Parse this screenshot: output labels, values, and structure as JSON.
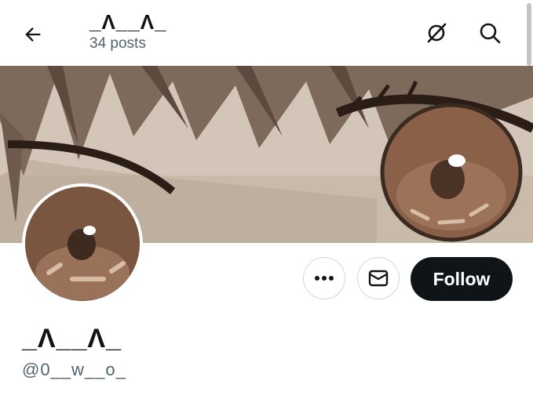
{
  "header": {
    "title": "_Λ__Λ_",
    "post_count": "34 posts",
    "back_icon": "arrow-left-icon",
    "actions": [
      {
        "icon": "grok-slash-icon"
      },
      {
        "icon": "search-icon"
      }
    ]
  },
  "banner": {
    "image": "anime-eye-closeup",
    "palette": {
      "skin": "#cdbfb1",
      "hair": "#7a6656",
      "iris": "#8a6148",
      "pupil": "#4a3326",
      "line": "#2a1d16"
    }
  },
  "profile": {
    "avatar_image": "eye-closeup-avatar",
    "display_name": "_Λ__Λ_",
    "handle": "@0__w__o_"
  },
  "actions": {
    "more_icon": "more-horizontal-icon",
    "message_icon": "envelope-icon",
    "follow_label": "Follow"
  },
  "colors": {
    "text": "#0f1419",
    "secondary_text": "#536471",
    "follow_bg": "#0f1419",
    "border": "#cfd9de"
  }
}
